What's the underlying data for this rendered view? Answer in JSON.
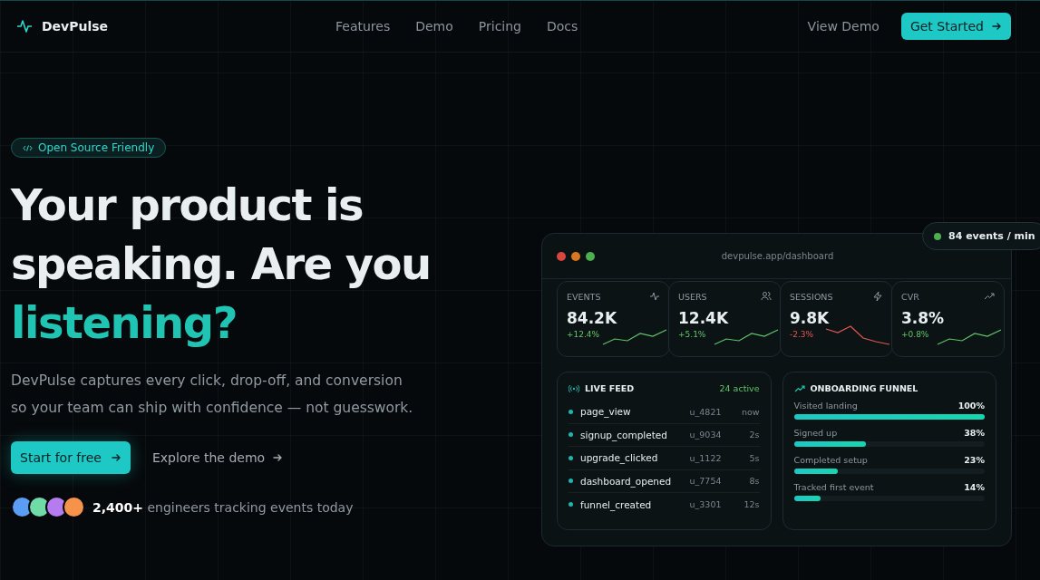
{
  "nav": {
    "brand": "DevPulse",
    "links": [
      {
        "label": "Features"
      },
      {
        "label": "Demo"
      },
      {
        "label": "Pricing"
      },
      {
        "label": "Docs"
      }
    ],
    "view_demo": "View Demo",
    "cta": "Get Started"
  },
  "hero": {
    "badge": "Open Source Friendly",
    "headline": "Your product is speaking. Are you",
    "headline_accent": "listening?",
    "description": "DevPulse captures every click, drop-off, and conversion so your team can ship with confidence — not guesswork.",
    "primary_button": "Start for free",
    "secondary_link": "Explore the demo",
    "avatars": [
      {
        "color": "#5b9cf5"
      },
      {
        "color": "#6fdca8"
      },
      {
        "color": "#b57cf0"
      },
      {
        "color": "#f5934a"
      }
    ],
    "social_proof": "**2,400+** engineers tracking events today"
  },
  "dashboard": {
    "url": "devpulse.app/dashboard",
    "live_badge": "84 events / min",
    "stats": [
      {
        "label": "EVENTS",
        "value": "84.2K",
        "delta": "+12.4%",
        "kind": "up"
      },
      {
        "label": "USERS",
        "value": "12.4K",
        "delta": "+5.1%",
        "kind": "up"
      },
      {
        "label": "SESSIONS",
        "value": "9.8K",
        "delta": "-2.3%",
        "kind": "down"
      },
      {
        "label": "CVR",
        "value": "3.8%",
        "delta": "+0.8%",
        "kind": "up"
      }
    ],
    "live_feed": {
      "title": "LIVE FEED",
      "active": "24 active",
      "events": [
        {
          "name": "page_view",
          "user": "u_4821",
          "time": "now"
        },
        {
          "name": "signup_completed",
          "user": "u_9034",
          "time": "2s"
        },
        {
          "name": "upgrade_clicked",
          "user": "u_1122",
          "time": "5s"
        },
        {
          "name": "dashboard_opened",
          "user": "u_7754",
          "time": "8s"
        },
        {
          "name": "funnel_created",
          "user": "u_3301",
          "time": "12s"
        }
      ]
    },
    "funnel": {
      "title": "ONBOARDING FUNNEL",
      "steps": [
        {
          "label": "Visited landing",
          "percent": "100%",
          "level": 1
        },
        {
          "label": "Signed up",
          "percent": "38%",
          "level": 0.38
        },
        {
          "label": "Completed setup",
          "percent": "23%",
          "level": 0.23
        },
        {
          "label": "Tracked first event",
          "percent": "14%",
          "level": 0.14
        }
      ]
    }
  }
}
